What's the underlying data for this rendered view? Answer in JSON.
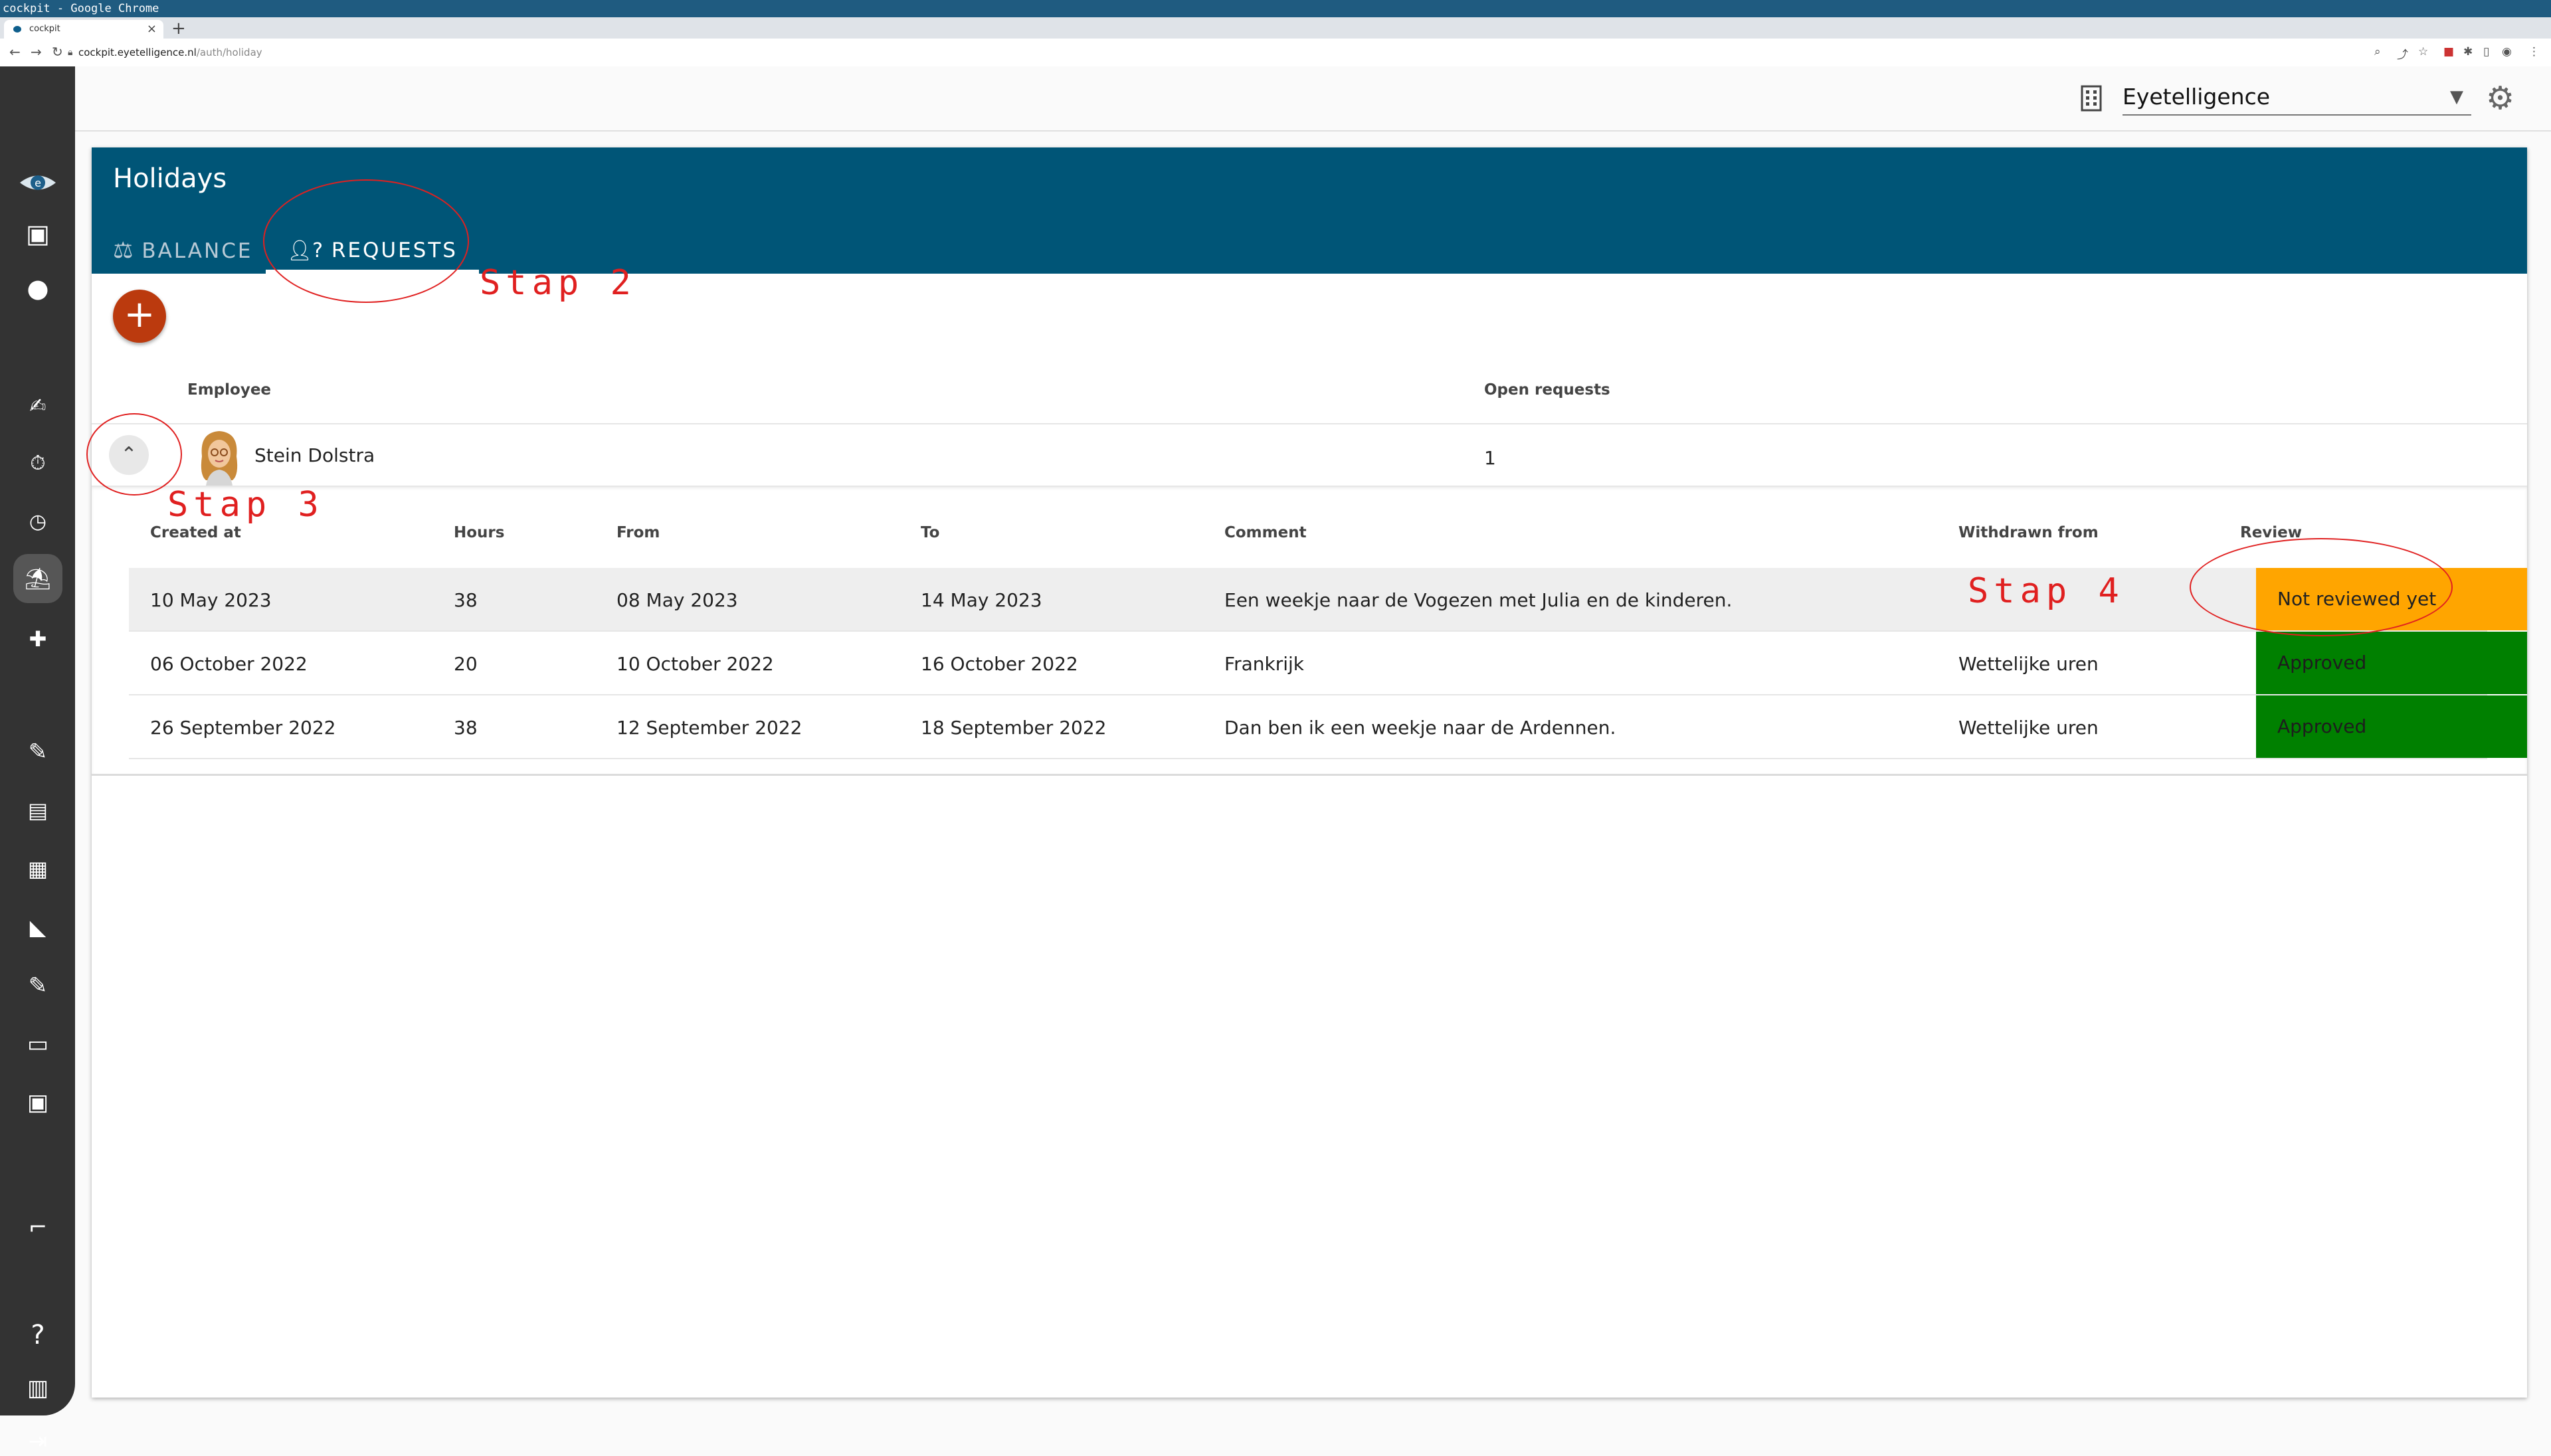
{
  "os_window_title": "cockpit - Google Chrome",
  "browser": {
    "tab_title": "cockpit",
    "tab_close": "×",
    "new_tab": "+",
    "url_host": "cockpit.eyetelligence.nl",
    "url_path": "/auth/holiday"
  },
  "topbar": {
    "company": "Eyetelligence"
  },
  "page": {
    "title": "Holidays",
    "tabs": [
      {
        "label": "BALANCE"
      },
      {
        "label": "REQUESTS"
      }
    ],
    "add_label": "+"
  },
  "employees_table": {
    "headers": {
      "employee": "Employee",
      "open_requests": "Open requests"
    },
    "rows": [
      {
        "name": "Stein Dolstra",
        "open_requests": "1"
      }
    ]
  },
  "requests_table": {
    "headers": {
      "created_at": "Created at",
      "hours": "Hours",
      "from": "From",
      "to": "To",
      "comment": "Comment",
      "withdrawn_from": "Withdrawn from",
      "review": "Review"
    },
    "rows": [
      {
        "created_at": "10 May 2023",
        "hours": "38",
        "from": "08 May 2023",
        "to": "14 May 2023",
        "comment": "Een weekje naar de Vogezen met Julia en de kinderen.",
        "withdrawn_from": "",
        "review": "Not reviewed yet"
      },
      {
        "created_at": "06 October 2022",
        "hours": "20",
        "from": "10 October 2022",
        "to": "16 October 2022",
        "comment": "Frankrijk",
        "withdrawn_from": "Wettelijke uren",
        "review": "Approved"
      },
      {
        "created_at": "26 September 2022",
        "hours": "38",
        "from": "12 September 2022",
        "to": "18 September 2022",
        "comment": "Dan ben ik een weekje naar de Ardennen.",
        "withdrawn_from": "Wettelijke uren",
        "review": "Approved"
      }
    ]
  },
  "annotations": [
    "Stap 2",
    "Stap 3",
    "Stap 4"
  ],
  "colors": {
    "header": "#005577",
    "sidebar": "#333333",
    "fab": "#bb3a0e",
    "pending": "#ffa500",
    "approved": "#008000",
    "annotation": "#e02020"
  },
  "icons": {
    "sidebar": [
      "calendar-icon",
      "person-icon",
      "sign-icon",
      "timer-list-icon",
      "clock-icon",
      "holiday-icon",
      "medical-bag-icon",
      "document-edit-icon",
      "cash-register-icon",
      "contact-card-icon",
      "security-camera-icon",
      "document-sign-icon",
      "monitor-icon",
      "money-icon",
      "stairs-icon",
      "help-icon",
      "manual-icon",
      "logout-icon"
    ]
  }
}
